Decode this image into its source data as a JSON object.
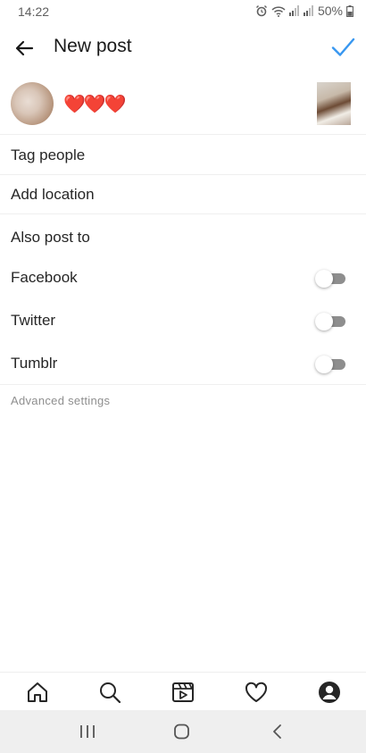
{
  "status_bar": {
    "time": "14:22",
    "battery": "50%"
  },
  "header": {
    "title": "New post"
  },
  "composer": {
    "caption": "❤️❤️❤️"
  },
  "menu": {
    "tag_people": "Tag people",
    "add_location": "Add location"
  },
  "share": {
    "heading": "Also post to",
    "options": [
      {
        "label": "Facebook",
        "enabled": false
      },
      {
        "label": "Twitter",
        "enabled": false
      },
      {
        "label": "Tumblr",
        "enabled": false
      }
    ]
  },
  "advanced_label": "Advanced settings",
  "colors": {
    "accent": "#3897f0",
    "toggle_off": "#8e8e8e",
    "heart": "#e0245e"
  },
  "bottom_nav": [
    "home-icon",
    "search-icon",
    "reels-icon",
    "heart-icon",
    "profile-icon"
  ],
  "system_nav": [
    "recents-icon",
    "home-circle-icon",
    "back-chevron-icon"
  ]
}
